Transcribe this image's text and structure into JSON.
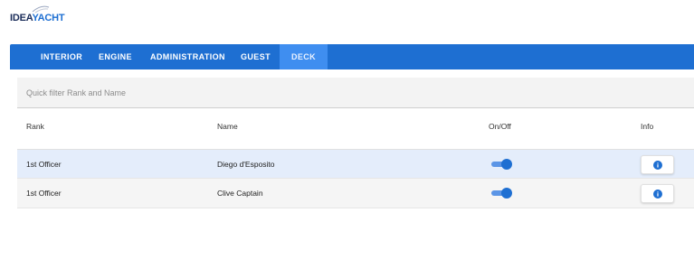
{
  "brand": {
    "part1": "IDEA",
    "part2": "YACHT"
  },
  "colors": {
    "primary": "#1e6fd2",
    "active_tab": "#3f8ef0",
    "selected_row": "#e4edfb"
  },
  "tabs": [
    {
      "label": "INTERIOR",
      "active": false
    },
    {
      "label": "ENGINE",
      "active": false
    },
    {
      "label": "ADMINISTRATION",
      "active": false
    },
    {
      "label": "GUEST",
      "active": false
    },
    {
      "label": "DECK",
      "active": true
    }
  ],
  "filter": {
    "placeholder": "Quick filter Rank and Name",
    "value": ""
  },
  "table": {
    "headers": {
      "rank": "Rank",
      "name": "Name",
      "onoff": "On/Off",
      "info": "Info"
    },
    "rows": [
      {
        "rank": "1st Officer",
        "name": "Diego d'Esposito",
        "on": true,
        "selected": true,
        "info_icon": "info-icon"
      },
      {
        "rank": "1st Officer",
        "name": "Clive Captain",
        "on": true,
        "selected": false,
        "info_icon": "info-icon"
      }
    ]
  }
}
